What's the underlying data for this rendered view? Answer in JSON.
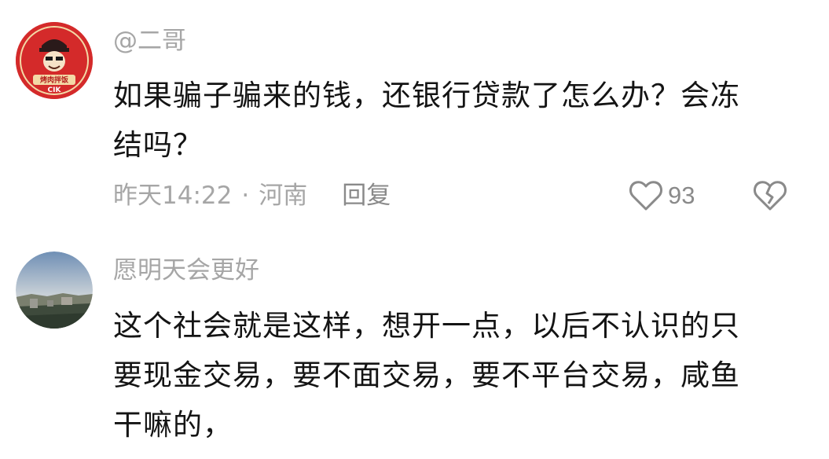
{
  "comments": [
    {
      "username": "@二哥",
      "avatar_icon": "cartoon-restaurant-logo-avatar",
      "avatar_lettering": [
        "烤肉拌饭",
        "CIK"
      ],
      "text_lines": [
        "如果骗子骗来的钱，还银行贷款了怎么办？会冻",
        "结吗？"
      ],
      "time": "昨天14:22",
      "separator": "·",
      "location": "河南",
      "reply_label": "回复",
      "likes": "93"
    },
    {
      "username": "愿明天会更好",
      "avatar_icon": "landscape-photo-avatar",
      "text_lines": [
        "这个社会就是这样，想开一点，以后不认识的只",
        "要现金交易，要不面交易，要不平台交易，咸鱼",
        "干嘛的，"
      ]
    }
  ],
  "colors": {
    "meta_gray": "#a6a6a6",
    "icon_gray": "#8a8a8a",
    "avatar_red": "#d42a2a"
  }
}
